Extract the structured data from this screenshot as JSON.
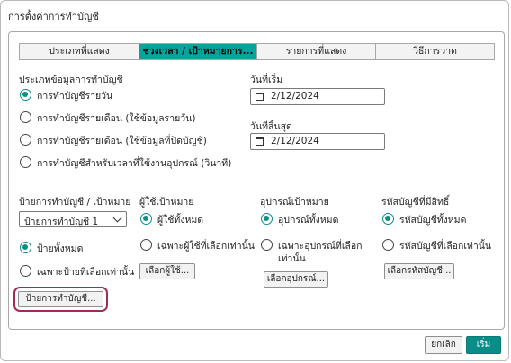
{
  "dialog": {
    "title": "การตั้งค่าการทำบัญชี"
  },
  "tabs": [
    {
      "label": "ประเภทที่แสดง",
      "active": false
    },
    {
      "label": "ช่วงเวลา / เป้าหมายการ...",
      "active": true
    },
    {
      "label": "รายการที่แสดง",
      "active": false
    },
    {
      "label": "วิธีการวาด",
      "active": false
    }
  ],
  "data_type": {
    "heading": "ประเภทข้อมูลการทำบัญชี",
    "options": [
      {
        "label": "การทำบัญชีรายวัน",
        "selected": true
      },
      {
        "label": "การทำบัญชีรายเดือน (ใช้ข้อมูลรายวัน)",
        "selected": false
      },
      {
        "label": "การทำบัญชีรายเดือน (ใช้ข้อมูลที่ปิดบัญชี)",
        "selected": false
      },
      {
        "label": "การทำบัญชีสำหรับเวลาที่ใช้งานอุปกรณ์ (วินาที)",
        "selected": false
      }
    ]
  },
  "dates": {
    "start_label": "วันที่เริ่ม",
    "start_value": "2/12/2024",
    "end_label": "วันที่สิ้นสุด",
    "end_value": "2/12/2024"
  },
  "label_target": {
    "heading": "ป้ายการทำบัญชี / เป้าหมาย",
    "select_value": "ป้ายการทำบัญชี 1",
    "opt_all": "ป้ายทั้งหมด",
    "opt_selected": "เฉพาะป้ายที่เลือกเท่านั้น",
    "button": "ป้ายการทำบัญชี..."
  },
  "user_target": {
    "heading": "ผู้ใช้เป้าหมาย",
    "opt_all": "ผู้ใช้ทั้งหมด",
    "opt_selected": "เฉพาะผู้ใช้ที่เลือกเท่านั้น",
    "button": "เลือกผู้ใช้..."
  },
  "device_target": {
    "heading": "อุปกรณ์เป้าหมาย",
    "opt_all": "อุปกรณ์ทั้งหมด",
    "opt_selected_line1": "เฉพาะอุปกรณ์ที่เลือก",
    "opt_selected_line2": "เท่านั้น",
    "button": "เลือกอุปกรณ์..."
  },
  "account_target": {
    "heading": "รหัสบัญชีที่มีสิทธิ์",
    "opt_all": "รหัสบัญชีทั้งหมด",
    "opt_selected": "รหัสบัญชีที่เลือกเท่านั้น",
    "button": "เลือกรหัสบัญชี..."
  },
  "footer": {
    "cancel": "ยกเลิก",
    "ok": "เริ่ม"
  },
  "colors": {
    "accent": "#0a8d88",
    "highlight": "#a02a58"
  }
}
